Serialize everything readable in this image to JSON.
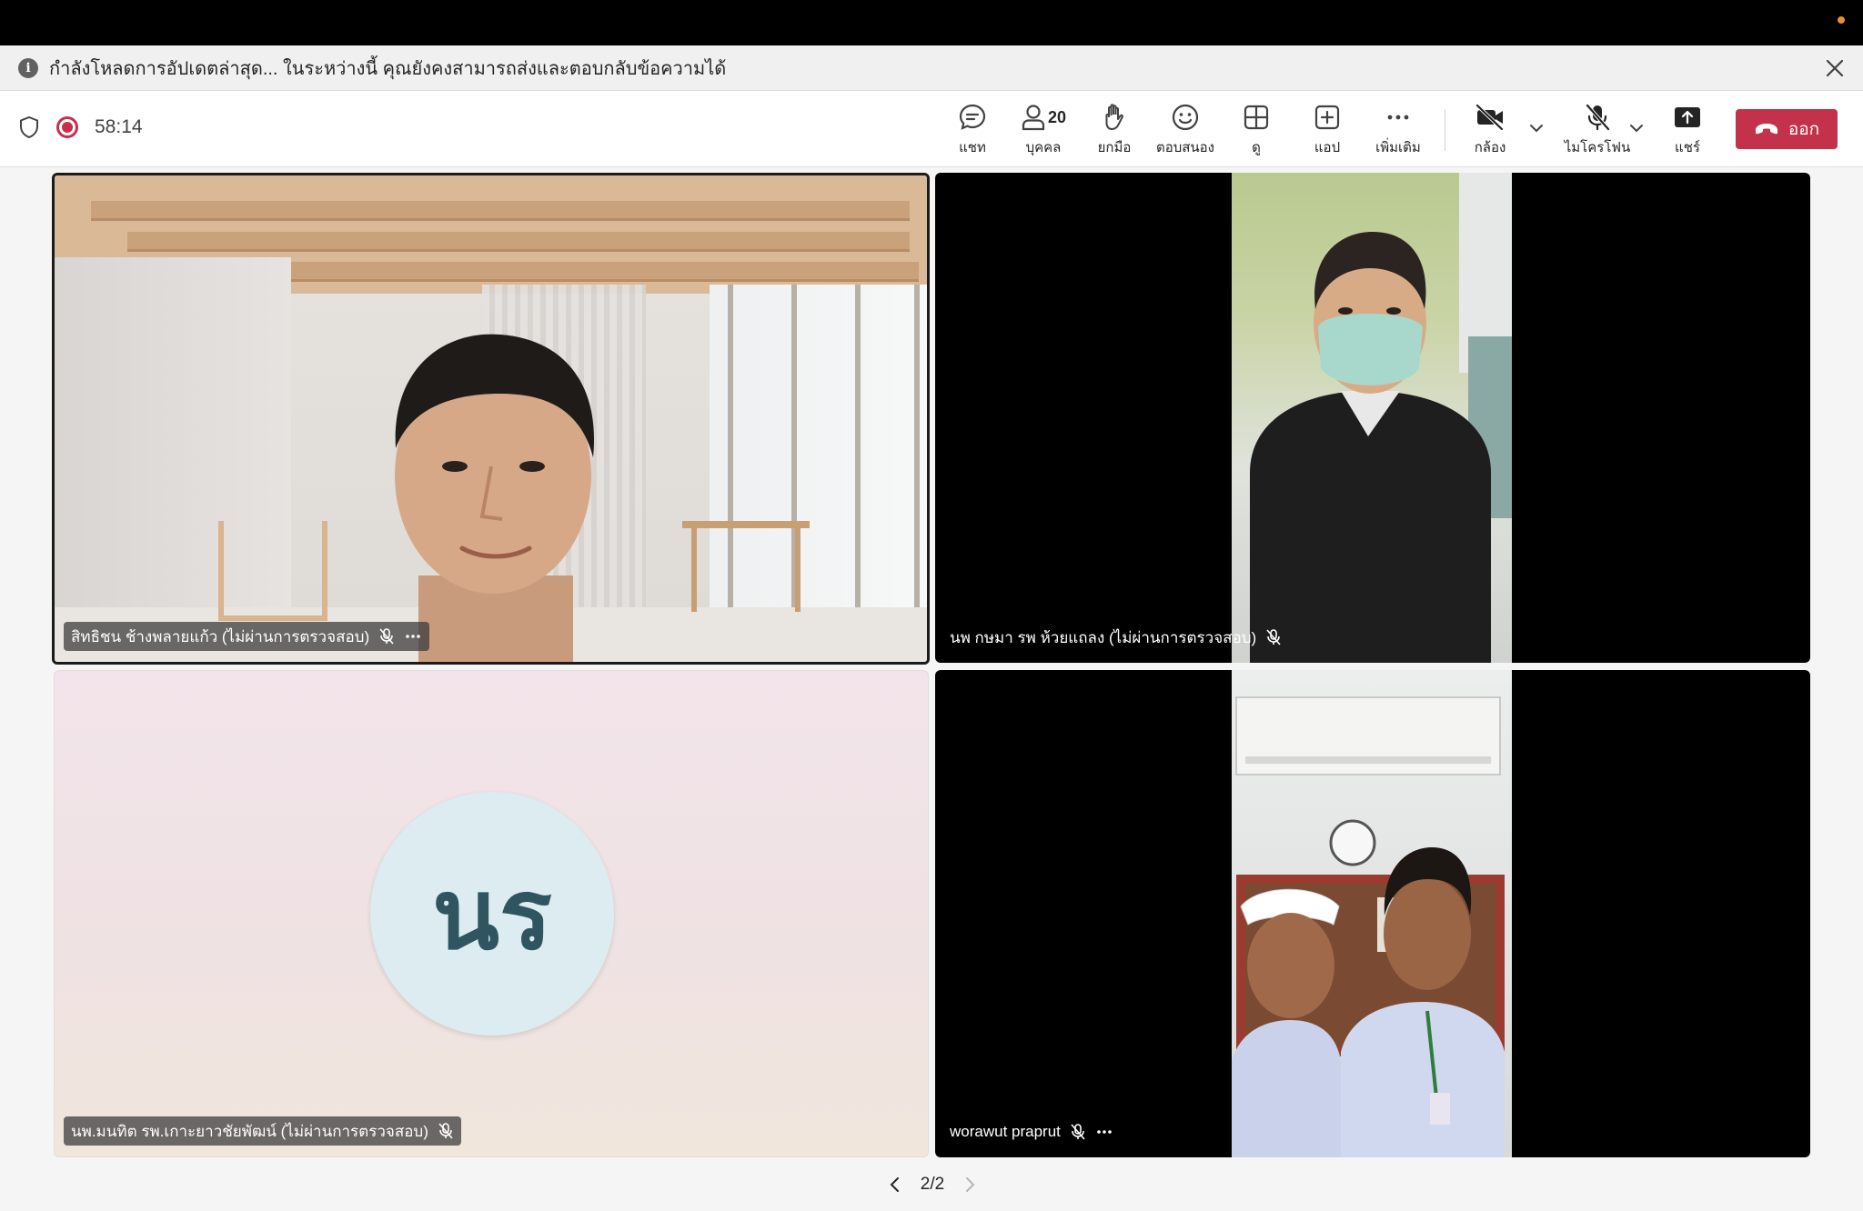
{
  "banner": {
    "message": "กำลังโหลดการอัปเดตล่าสุด... ในระหว่างนี้ คุณยังคงสามารถส่งและตอบกลับข้อความได้"
  },
  "meeting": {
    "timer": "58:14"
  },
  "toolbar": {
    "chat_label": "แชท",
    "people_label": "บุคคล",
    "people_count": "20",
    "raise_hand_label": "ยกมือ",
    "react_label": "ตอบสนอง",
    "view_label": "ดู",
    "apps_label": "แอป",
    "more_label": "เพิ่มเติม",
    "camera_label": "กล้อง",
    "mic_label": "ไมโครโฟน",
    "share_label": "แชร์",
    "leave_label": "ออก"
  },
  "participants": [
    {
      "name": "สิทธิชน ช้างพลายแก้ว (ไม่ผ่านการตรวจสอบ)"
    },
    {
      "name": "นพ กษมา รพ ห้วยแถลง (ไม่ผ่านการตรวจสอบ)"
    },
    {
      "name": "นพ.มนทิต รพ.เกาะยาวชัยพัฒน์ (ไม่ผ่านการตรวจสอบ)",
      "initials": "นร"
    },
    {
      "name": "worawut praprut"
    }
  ],
  "pagination": {
    "label": "2/2"
  },
  "colors": {
    "leave": "#c4314b",
    "record": "#c4314b"
  }
}
